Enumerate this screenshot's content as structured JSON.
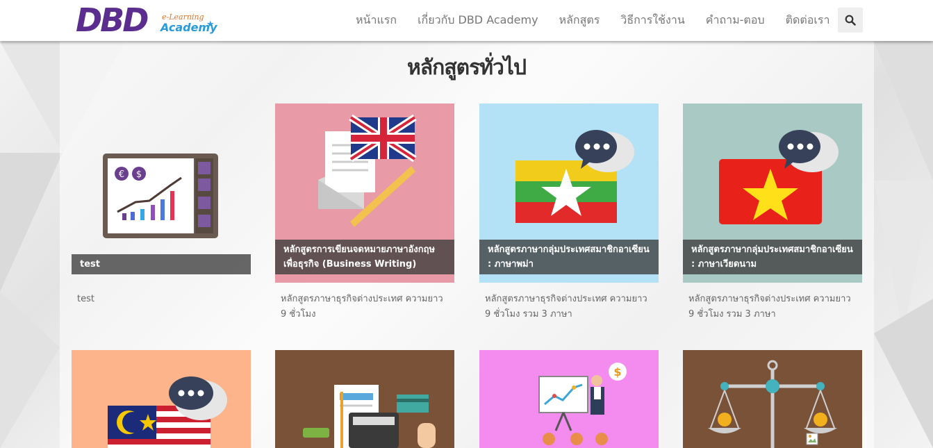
{
  "header": {
    "logo": {
      "main": "DBD",
      "sub1": "e-Learning",
      "sub2": "Academy"
    },
    "nav": [
      {
        "label": "หน้าแรก"
      },
      {
        "label": "เกี่ยวกับ DBD Academy"
      },
      {
        "label": "หลักสูตร"
      },
      {
        "label": "วิธีการใช้งาน"
      },
      {
        "label": "คำถาม-ตอบ"
      },
      {
        "label": "ติดต่อเรา"
      }
    ],
    "search_icon": "search-icon"
  },
  "page": {
    "title": "หลักสูตรทั่วไป"
  },
  "courses": [
    {
      "title": "test",
      "description": "test",
      "bg": "#ffffff",
      "icon": "finance-board-icon"
    },
    {
      "title": "หลักสูตรการเขียนจดหมายภาษาอังกฤษเพื่อธุรกิจ (Business Writing)",
      "description": "หลักสูตรภาษาธุรกิจต่างประเทศ ความยาว 9 ชั่วโมง",
      "bg": "#e89ba6",
      "icon": "uk-letter-icon"
    },
    {
      "title": "หลักสูตรภาษากลุ่มประเทศสมาชิกอาเซียน : ภาษาพม่า",
      "description": "หลักสูตรภาษาธุรกิจต่างประเทศ ความยาว 9 ชั่วโมง รวม 3 ภาษา",
      "bg": "#b3e2f7",
      "icon": "myanmar-flag-icon"
    },
    {
      "title": "หลักสูตรภาษากลุ่มประเทศสมาชิกอาเซียน : ภาษาเวียดนาม",
      "description": "หลักสูตรภาษาธุรกิจต่างประเทศ ความยาว 9 ชั่วโมง รวม 3 ภาษา",
      "bg": "#a9c9c4",
      "icon": "vietnam-flag-icon"
    },
    {
      "title": "",
      "description": "",
      "bg": "#fdb48b",
      "icon": "malaysia-flag-icon"
    },
    {
      "title": "",
      "description": "",
      "bg": "#7a5238",
      "icon": "accounting-icon"
    },
    {
      "title": "",
      "description": "",
      "bg": "#f48cf0",
      "icon": "presentation-icon"
    },
    {
      "title": "",
      "description": "",
      "bg": "#7a5238",
      "icon": "scale-icon"
    }
  ]
}
